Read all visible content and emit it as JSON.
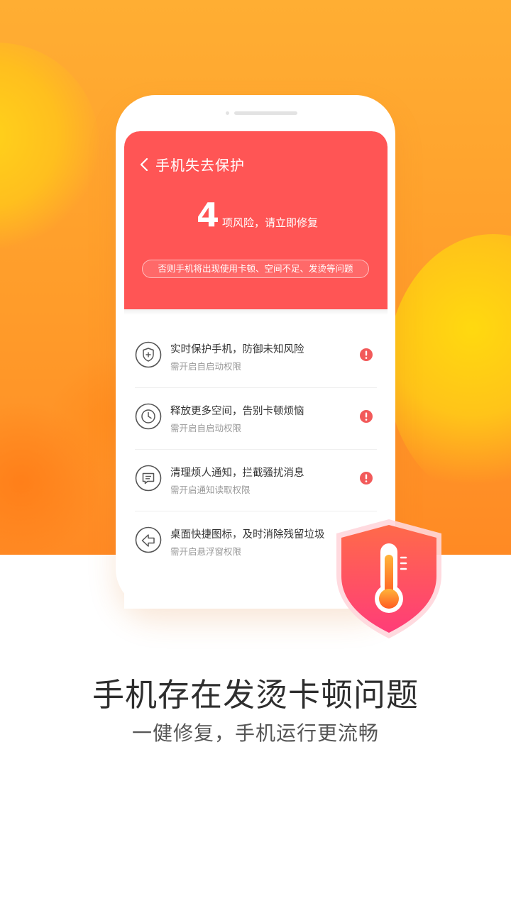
{
  "screen": {
    "title": "手机失去保护",
    "back_icon": "chevron-left-icon",
    "risk_count": "4",
    "risk_text": "项风险，请立即修复",
    "warning": "否则手机将出现使用卡顿、空间不足、发烫等问题",
    "header_color": "#ff5555"
  },
  "items": [
    {
      "icon": "shield-plus-icon",
      "title": "实时保护手机，防御未知风险",
      "subtitle": "需开启自启动权限",
      "alert": true
    },
    {
      "icon": "clock-icon",
      "title": "释放更多空间，告别卡顿烦恼",
      "subtitle": "需开启自启动权限",
      "alert": true
    },
    {
      "icon": "message-icon",
      "title": "清理烦人通知，拦截骚扰消息",
      "subtitle": "需开启通知读取权限",
      "alert": true
    },
    {
      "icon": "shortcut-icon",
      "title": "桌面快捷图标，及时消除残留垃圾",
      "subtitle": "需开启悬浮窗权限",
      "alert": false
    }
  ],
  "badge": {
    "icon": "thermometer-shield-icon"
  },
  "headline": "手机存在发烫卡顿问题",
  "subline": "一健修复，手机运行更流畅",
  "colors": {
    "accent": "#ff5555",
    "background_top": "#ffa430",
    "alert": "#f25a5a"
  }
}
